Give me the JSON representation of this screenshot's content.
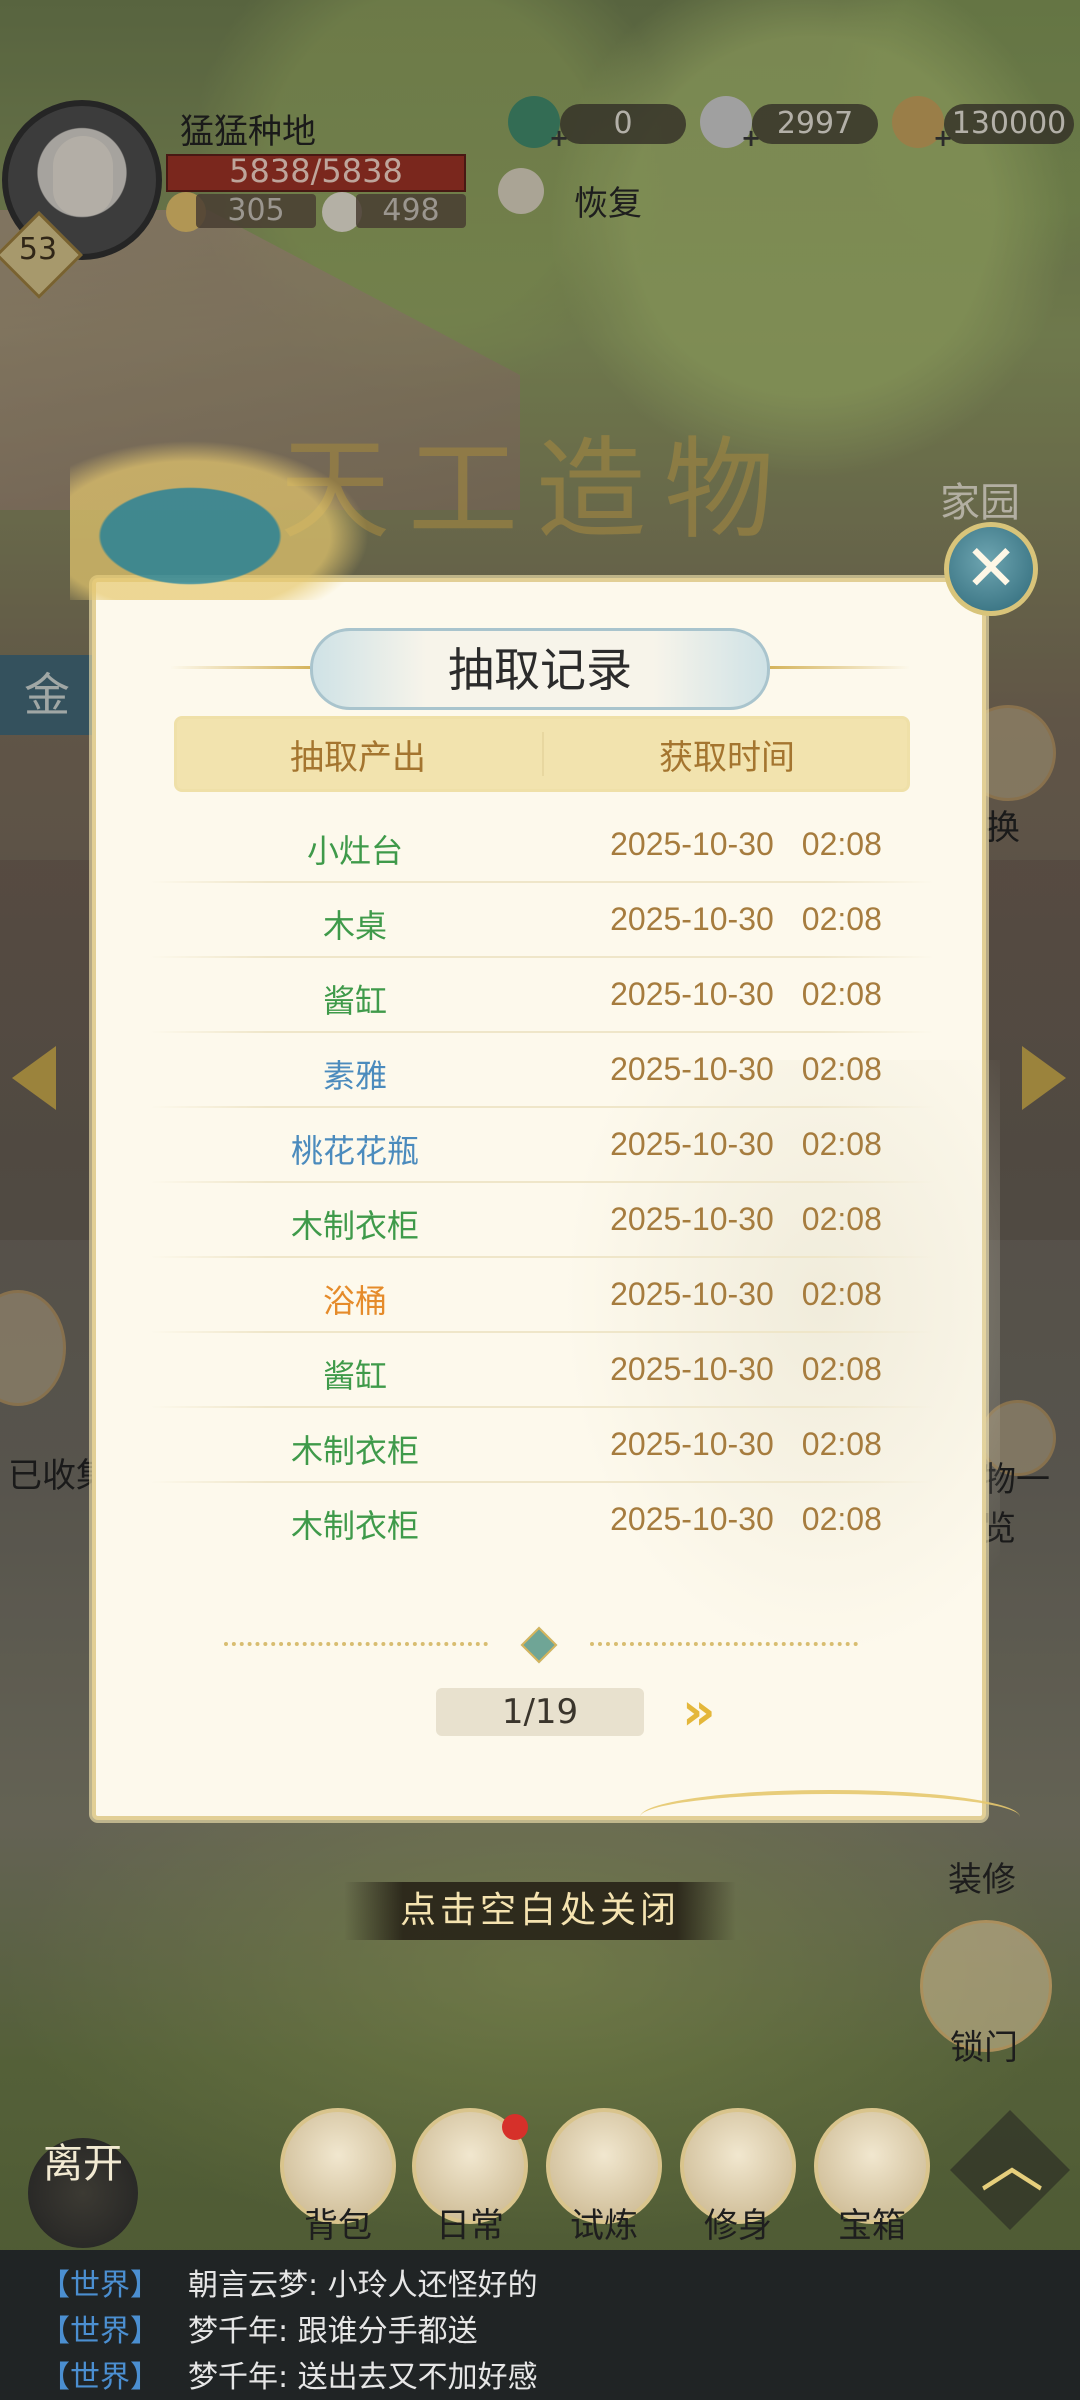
{
  "hud": {
    "player_name": "猛猛种地",
    "hp": "5838/5838",
    "level": "53",
    "stat_a": "305",
    "stat_b": "498",
    "jade": "0",
    "silver": "2997",
    "copper": "130000",
    "recover_label": "恢复"
  },
  "background": {
    "title": "天工造物",
    "tab_left": "金",
    "tab_right": "家园",
    "collected": "已收集",
    "overview": "物一览",
    "swap": "换"
  },
  "modal": {
    "title": "抽取记录",
    "col_item": "抽取产出",
    "col_time": "获取时间",
    "rows": [
      {
        "item": "小灶台",
        "date": "2025-10-30",
        "time": "02:08",
        "color": "#3f9a4a"
      },
      {
        "item": "木桌",
        "date": "2025-10-30",
        "time": "02:08",
        "color": "#3f9a4a"
      },
      {
        "item": "酱缸",
        "date": "2025-10-30",
        "time": "02:08",
        "color": "#3f9a4a"
      },
      {
        "item": "素雅",
        "date": "2025-10-30",
        "time": "02:08",
        "color": "#4b8bbd"
      },
      {
        "item": "桃花花瓶",
        "date": "2025-10-30",
        "time": "02:08",
        "color": "#4b8bbd"
      },
      {
        "item": "木制衣柜",
        "date": "2025-10-30",
        "time": "02:08",
        "color": "#3f9a4a"
      },
      {
        "item": "浴桶",
        "date": "2025-10-30",
        "time": "02:08",
        "color": "#e58b2a"
      },
      {
        "item": "酱缸",
        "date": "2025-10-30",
        "time": "02:08",
        "color": "#3f9a4a"
      },
      {
        "item": "木制衣柜",
        "date": "2025-10-30",
        "time": "02:08",
        "color": "#3f9a4a"
      },
      {
        "item": "木制衣柜",
        "date": "2025-10-30",
        "time": "02:08",
        "color": "#3f9a4a"
      }
    ],
    "page": "1/19",
    "close_hint": "点击空白处关闭"
  },
  "side": {
    "decorate": "装修",
    "lock": "锁门"
  },
  "nav": {
    "leave": "离开",
    "items": [
      "背包",
      "日常",
      "试炼",
      "修身",
      "宝箱"
    ]
  },
  "chat": [
    {
      "channel": "【世界】",
      "text": "朝言云梦: 小玲人还怪好的"
    },
    {
      "channel": "【世界】",
      "text": "梦千年: 跟谁分手都送"
    },
    {
      "channel": "【世界】",
      "text": "梦千年: 送出去又不加好感"
    }
  ],
  "colors": {
    "accent_gold": "#d5b45c",
    "time_text": "#a67c3e",
    "chat_channel": "#4b8fd1"
  }
}
